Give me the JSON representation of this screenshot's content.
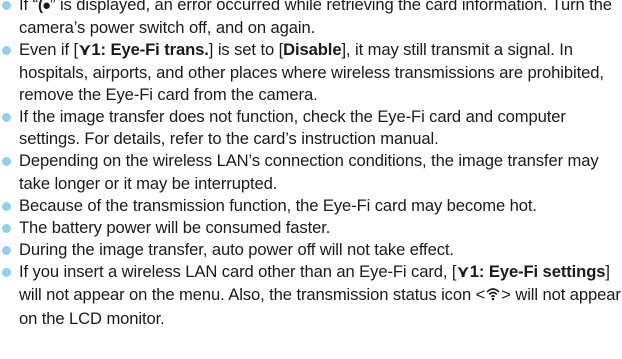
{
  "notes": [
    {
      "pre": "If “",
      "icon": "card-error-icon",
      "icon_glyph": "(●",
      "post": "” is displayed, an error occurred while retrieving the card information. Turn the camera’s power switch off, and on again."
    },
    {
      "pre": "Even if [",
      "menu_icon": "wrench-tab-icon",
      "menu_icon_glyph": "⋎1: Eye-Fi trans.",
      "mid": "] is set to [",
      "value": "Disable",
      "post": "], it may still transmit a signal. In hospitals, airports, and other places where wireless transmissions are prohibited, remove the Eye-Fi card from the camera."
    },
    {
      "text": "If the image transfer does not function, check the Eye-Fi card and computer settings. For details, refer to the card’s instruction manual."
    },
    {
      "text": "Depending on the wireless LAN’s connection conditions, the image transfer may take longer or it may be interrupted."
    },
    {
      "text": "Because of the transmission function, the Eye-Fi card may become hot."
    },
    {
      "text": "The battery power will be consumed faster."
    },
    {
      "text": "During the image transfer, auto power off will not take effect."
    },
    {
      "pre": "If you insert a wireless LAN card other than an Eye-Fi card, [",
      "menu_glyph": "⋎1: Eye-Fi settings",
      "mid": "] will not appear on the menu. Also, the transmission status icon <",
      "icon": "transmission-status-icon",
      "post": "> will not appear on the LCD monitor."
    }
  ],
  "colors": {
    "bullet": "#8fd0ec",
    "text": "#1a1a1a"
  }
}
